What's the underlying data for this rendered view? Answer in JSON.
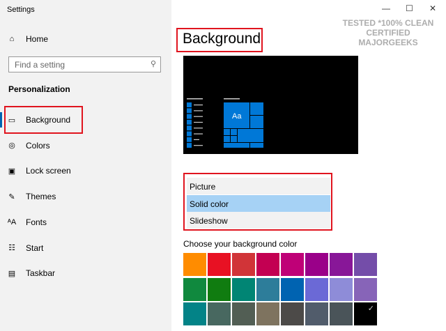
{
  "window": {
    "title": "Settings",
    "minimize": "—",
    "maximize": "☐",
    "close": "✕"
  },
  "sidebar": {
    "home": "Home",
    "search_placeholder": "Find a setting",
    "section": "Personalization",
    "items": [
      {
        "label": "Background",
        "icon": "picture-icon",
        "glyph": "▭"
      },
      {
        "label": "Colors",
        "icon": "palette-icon",
        "glyph": "◎"
      },
      {
        "label": "Lock screen",
        "icon": "lock-screen-icon",
        "glyph": "▣"
      },
      {
        "label": "Themes",
        "icon": "themes-icon",
        "glyph": "✎"
      },
      {
        "label": "Fonts",
        "icon": "fonts-icon",
        "glyph": "ᴬA"
      },
      {
        "label": "Start",
        "icon": "start-icon",
        "glyph": "☷"
      },
      {
        "label": "Taskbar",
        "icon": "taskbar-icon",
        "glyph": "▤"
      }
    ]
  },
  "main": {
    "title": "Background",
    "preview_tile_label": "Aa",
    "dropdown": {
      "options": [
        "Picture",
        "Solid color",
        "Slideshow"
      ],
      "selected": "Solid color"
    },
    "color_label": "Choose your background color",
    "colors": [
      "#ff8c00",
      "#e81123",
      "#d13438",
      "#c30052",
      "#bf0077",
      "#9a0089",
      "#881798",
      "#744da9",
      "#10893e",
      "#107c10",
      "#018574",
      "#2d7d9a",
      "#0063b1",
      "#6b69d6",
      "#8e8cd8",
      "#8764b8",
      "#038387",
      "#486860",
      "#525e54",
      "#7e735f",
      "#4c4a48",
      "#515c6b",
      "#4a5459",
      "#000000"
    ],
    "selected_color": "#000000",
    "accent": "#0078d7"
  },
  "watermark": "TESTED *100% CLEAN CERTIFIED MAJORGEEKS"
}
